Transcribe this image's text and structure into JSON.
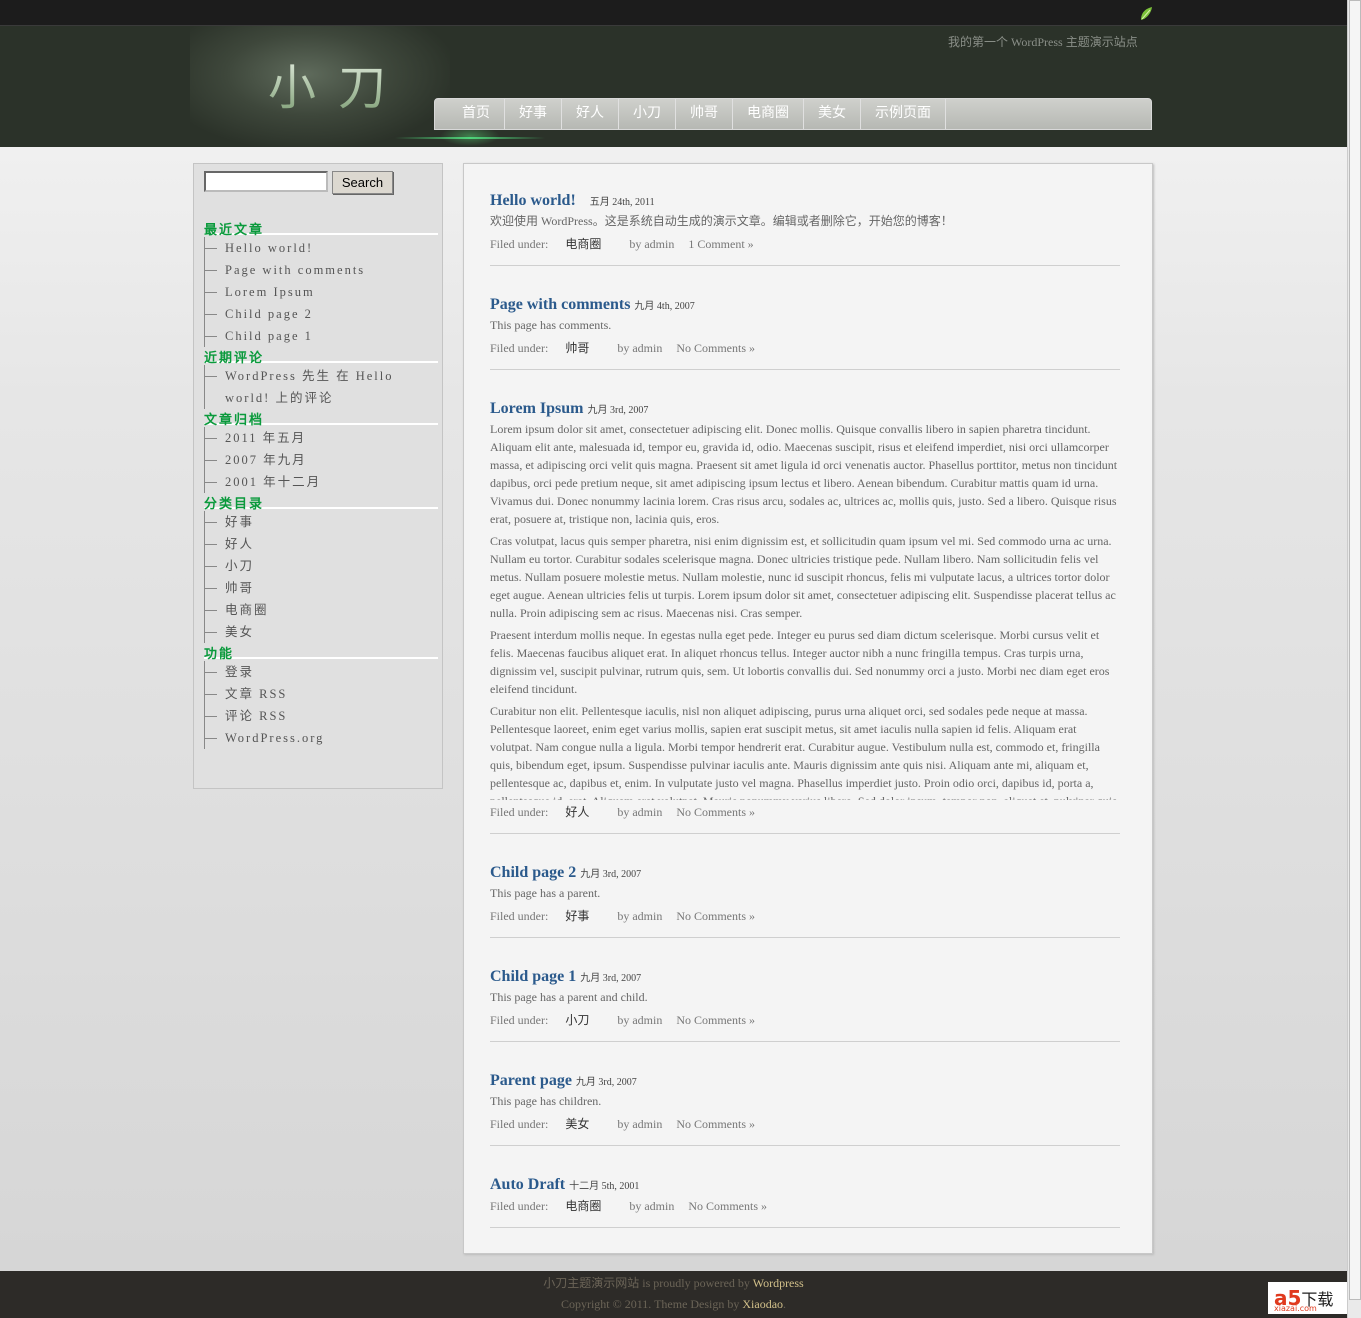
{
  "site": {
    "logo": "小刀",
    "tagline": "我的第一个 WordPress 主题演示站点"
  },
  "nav": [
    "首页",
    "好事",
    "好人",
    "小刀",
    "帅哥",
    "电商圈",
    "美女",
    "示例页面"
  ],
  "search": {
    "button": "Search",
    "value": ""
  },
  "sidebar": [
    {
      "title": "最近文章",
      "items": [
        "Hello world!",
        "Page with comments",
        "Lorem Ipsum",
        "Child page 2",
        "Child page 1"
      ]
    },
    {
      "title": "近期评论",
      "items": [
        "WordPress 先生 在 Hello world! 上的评论"
      ]
    },
    {
      "title": "文章归档",
      "items": [
        "2011 年五月",
        "2007 年九月",
        "2001 年十二月"
      ]
    },
    {
      "title": "分类目录",
      "items": [
        "好事",
        "好人",
        "小刀",
        "帅哥",
        "电商圈",
        "美女"
      ]
    },
    {
      "title": "功能",
      "items": [
        "登录",
        "文章 RSS",
        "评论 RSS",
        "WordPress.org"
      ]
    }
  ],
  "posts": [
    {
      "title": "Hello world!",
      "date": "五月 24th, 2011",
      "body": [
        "欢迎使用 WordPress。这是系统自动生成的演示文章。编辑或者删除它，开始您的博客！"
      ],
      "filed_label": "Filed under:",
      "category": "电商圈",
      "author": "by admin",
      "comments": "1 Comment »"
    },
    {
      "title": "Page with comments",
      "date": "九月 4th, 2007",
      "body": [
        "This page has comments."
      ],
      "filed_label": "Filed under:",
      "category": "帅哥",
      "author": "by admin",
      "comments": "No Comments »"
    },
    {
      "title": "Lorem Ipsum",
      "date": "九月 3rd, 2007",
      "clip": true,
      "body": [
        "Lorem ipsum dolor sit amet, consectetuer adipiscing elit. Donec mollis. Quisque convallis libero in sapien pharetra tincidunt. Aliquam elit ante, malesuada id, tempor eu, gravida id, odio. Maecenas suscipit, risus et eleifend imperdiet, nisi orci ullamcorper massa, et adipiscing orci velit quis magna. Praesent sit amet ligula id orci venenatis auctor. Phasellus porttitor, metus non tincidunt dapibus, orci pede pretium neque, sit amet adipiscing ipsum lectus et libero. Aenean bibendum. Curabitur mattis quam id urna. Vivamus dui. Donec nonummy lacinia lorem. Cras risus arcu, sodales ac, ultrices ac, mollis quis, justo. Sed a libero. Quisque risus erat, posuere at, tristique non, lacinia quis, eros.",
        "Cras volutpat, lacus quis semper pharetra, nisi enim dignissim est, et sollicitudin quam ipsum vel mi. Sed commodo urna ac urna. Nullam eu tortor. Curabitur sodales scelerisque magna. Donec ultricies tristique pede. Nullam libero. Nam sollicitudin felis vel metus. Nullam posuere molestie metus. Nullam molestie, nunc id suscipit rhoncus, felis mi vulputate lacus, a ultrices tortor dolor eget augue. Aenean ultricies felis ut turpis. Lorem ipsum dolor sit amet, consectetuer adipiscing elit. Suspendisse placerat tellus ac nulla. Proin adipiscing sem ac risus. Maecenas nisi. Cras semper.",
        "Praesent interdum mollis neque. In egestas nulla eget pede. Integer eu purus sed diam dictum scelerisque. Morbi cursus velit et felis. Maecenas faucibus aliquet erat. In aliquet rhoncus tellus. Integer auctor nibh a nunc fringilla tempus. Cras turpis urna, dignissim vel, suscipit pulvinar, rutrum quis, sem. Ut lobortis convallis dui. Sed nonummy orci a justo. Morbi nec diam eget eros eleifend tincidunt.",
        "Curabitur non elit. Pellentesque iaculis, nisl non aliquet adipiscing, purus urna aliquet orci, sed sodales pede neque at massa. Pellentesque laoreet, enim eget varius mollis, sapien erat suscipit metus, sit amet iaculis nulla sapien id felis. Aliquam erat volutpat. Nam congue nulla a ligula. Morbi tempor hendrerit erat. Curabitur augue. Vestibulum nulla est, commodo et, fringilla quis, bibendum eget, ipsum. Suspendisse pulvinar iaculis ante. Mauris dignissim ante quis nisi. Aliquam ante mi, aliquam et, pellentesque ac, dapibus et, enim. In vulputate justo vel magna. Phasellus imperdiet justo. Proin odio orci, dapibus id, porta a, pellentesque id, erat. Aliquam erat volutpat. Mauris nonummy varius libero. Sed dolor ipsum, tempor non, aliquet et, pulvinar quis, dui."
      ],
      "filed_label": "Filed under:",
      "category": "好人",
      "author": "by admin",
      "comments": "No Comments »"
    },
    {
      "title": "Child page 2",
      "date": "九月 3rd, 2007",
      "body": [
        "This page has a parent."
      ],
      "filed_label": "Filed under:",
      "category": "好事",
      "author": "by admin",
      "comments": "No Comments »"
    },
    {
      "title": "Child page 1",
      "date": "九月 3rd, 2007",
      "body": [
        "This page has a parent and child."
      ],
      "filed_label": "Filed under:",
      "category": "小刀",
      "author": "by admin",
      "comments": "No Comments »"
    },
    {
      "title": "Parent page",
      "date": "九月 3rd, 2007",
      "body": [
        "This page has children."
      ],
      "filed_label": "Filed under:",
      "category": "美女",
      "author": "by admin",
      "comments": "No Comments »"
    },
    {
      "title": "Auto Draft",
      "date": "十二月 5th, 2001",
      "body": [],
      "filed_label": "Filed under:",
      "category": "电商圈",
      "author": "by admin",
      "comments": "No Comments »"
    }
  ],
  "footer": {
    "site_name": "小刀主题演示网站",
    "powered": " is proudly powered by ",
    "wordpress": "Wordpress",
    "copyright": "Copyright © 2011. Theme Design by ",
    "designer": "Xiaodao",
    "dot": "."
  },
  "badge": {
    "brand": "a5",
    "text": "下载",
    "domain": "xiazai.com"
  },
  "colors": {
    "accent_green": "#0a9a3c",
    "title_blue": "#2b5a8c",
    "header": "#2b3229",
    "footer": "#2d2b28"
  }
}
